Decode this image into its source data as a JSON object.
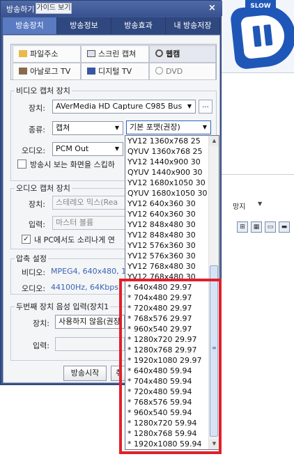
{
  "window": {
    "title": "방송하기",
    "guide_label": "가이드 보기",
    "close_label": "×"
  },
  "tabs": [
    {
      "label": "방송장치",
      "active": true
    },
    {
      "label": "방송정보",
      "active": false
    },
    {
      "label": "방송효과",
      "active": false
    },
    {
      "label": "내 방송저장",
      "active": false
    }
  ],
  "sources": [
    {
      "label": "파일주소",
      "icon": "folder-icon",
      "selected": false
    },
    {
      "label": "스크린 캡쳐",
      "icon": "monitor-icon",
      "selected": false
    },
    {
      "label": "웹캠",
      "icon": "webcam-icon",
      "selected": true
    },
    {
      "label": "아날로그 TV",
      "icon": "tv-icon",
      "selected": false
    },
    {
      "label": "디지털 TV",
      "icon": "digital-tv-icon",
      "selected": false
    },
    {
      "label": "DVD",
      "icon": "dvd-icon",
      "selected": false
    }
  ],
  "video_capture": {
    "group_title": "비디오 캡처 장치",
    "device_label": "장치:",
    "device_value": "AVerMedia HD Capture C985 Bus",
    "device_more": "...",
    "type_label": "종류:",
    "type_value": "캡쳐",
    "format_value": "기본 포맷(권장)",
    "audio_label": "오디오:",
    "audio_value": "PCM Out",
    "option_label": "방송시 보는 화면을 스킵하",
    "option_checked": false
  },
  "audio_capture": {
    "group_title": "오디오 캡처 장치",
    "device_label": "장치:",
    "device_value": "스테레오 믹스(Rea",
    "input_label": "입력:",
    "input_value": "마스터 볼륨",
    "pc_sound_label": "내 PC에서도 소리나게 연",
    "pc_sound_checked": true
  },
  "compression": {
    "group_title": "압축 설정",
    "video_label": "비디오:",
    "video_value": "MPEG4, 640x480, 1",
    "audio_label": "오디오:",
    "audio_value": "44100Hz, 64Kbps"
  },
  "second_audio": {
    "group_title": "두번째 장치 음성 입력(장치1",
    "device_label": "장치:",
    "device_value": "사용하지 않음(권장",
    "input_label": "입력:",
    "input_value": ""
  },
  "footer": {
    "start_label": "방송시작",
    "cancel_label": "취"
  },
  "format_dropdown": {
    "items": [
      "YV12 1360x768 25",
      "QYUV 1360x768 25",
      "YV12 1440x900 30",
      "QYUV 1440x900 30",
      "YV12 1680x1050 30",
      "QYUV 1680x1050 30",
      "YV12 640x360 30",
      "YV12 640x360 30",
      "YV12 848x480 30",
      "YV12 848x480 30",
      "YV12 576x360 30",
      "YV12 576x360 30",
      "YV12 768x480 30",
      "YV12 768x480 30",
      "* 640x480 29.97",
      "* 704x480 29.97",
      "* 720x480 29.97",
      "* 768x576 29.97",
      "* 960x540 29.97",
      "* 1280x720 29.97",
      "* 1280x768 29.97",
      "* 1920x1080 29.97",
      "* 640x480 59.94",
      "* 704x480 59.94",
      "* 720x480 59.94",
      "* 768x576 59.94",
      "* 960x540 59.94",
      "* 1280x720 59.94",
      "* 1280x768 59.94",
      "* 1920x1080 59.94"
    ],
    "scroll_thumb_grip": "≡"
  },
  "background_app": {
    "logo_tag": "SLOW",
    "toolbar_text": "망지",
    "toolbar_arrow": "▼"
  },
  "colors": {
    "window_frame": "#3b5591",
    "active_tab": "#5a7ac2",
    "highlight_box": "#e0202a",
    "info_text": "#3a63b5"
  }
}
